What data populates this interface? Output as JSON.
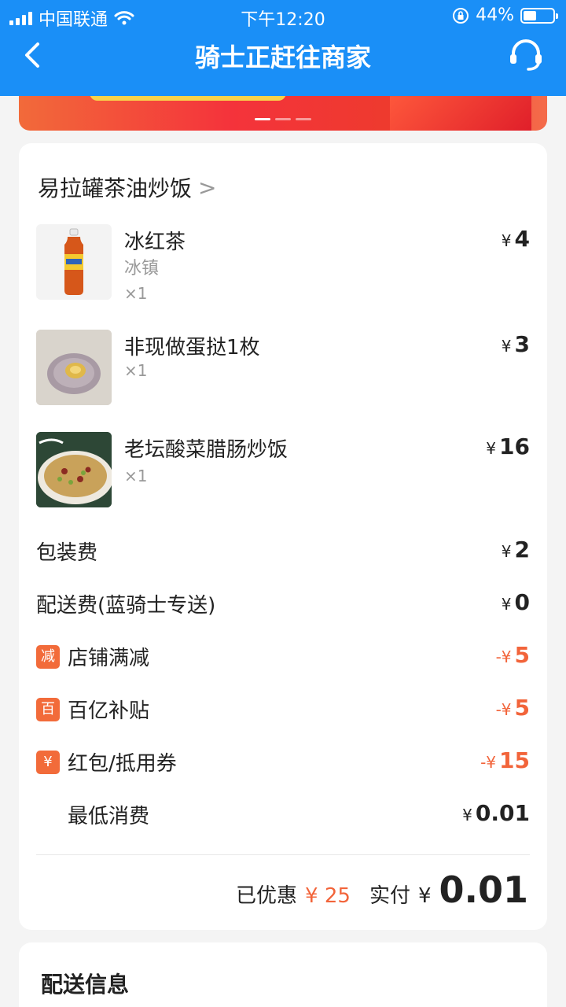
{
  "status": {
    "carrier": "中国联通",
    "time": "下午12:20",
    "battery": "44%",
    "battery_level": 0.44
  },
  "nav": {
    "title": "骑士正赶往商家"
  },
  "shop": {
    "name": "易拉罐茶油炒饭",
    "chevron": ">"
  },
  "items": [
    {
      "name": "冰红茶",
      "spec": "冰镇",
      "qty": "×1",
      "currency": "¥",
      "price": "4"
    },
    {
      "name": "非现做蛋挞1枚",
      "spec": "",
      "qty": "×1",
      "currency": "¥",
      "price": "3"
    },
    {
      "name": "老坛酸菜腊肠炒饭",
      "spec": "",
      "qty": "×1",
      "currency": "¥",
      "price": "16"
    }
  ],
  "fees": {
    "packing": {
      "label": "包装费",
      "currency": "¥",
      "value": "2"
    },
    "delivery": {
      "label": "配送费(蓝骑士专送)",
      "currency": "¥",
      "value": "0"
    }
  },
  "discounts": [
    {
      "tag": "减",
      "label": "店铺满减",
      "currency": "-¥",
      "value": "5"
    },
    {
      "tag": "百",
      "label": "百亿补贴",
      "currency": "-¥",
      "value": "5"
    },
    {
      "tag": "¥",
      "label": "红包/抵用券",
      "currency": "-¥",
      "value": "15"
    }
  ],
  "minimum": {
    "label": "最低消费",
    "currency": "¥",
    "value": "0.01"
  },
  "summary": {
    "saved_label": "已优惠",
    "saved_value": "¥ 25",
    "paid_label": "实付",
    "paid_currency": "¥",
    "paid_value": "0.01"
  },
  "delivery_section": {
    "title": "配送信息"
  },
  "colors": {
    "header_blue": "#1a8ff7",
    "discount_red": "#f2643a"
  }
}
